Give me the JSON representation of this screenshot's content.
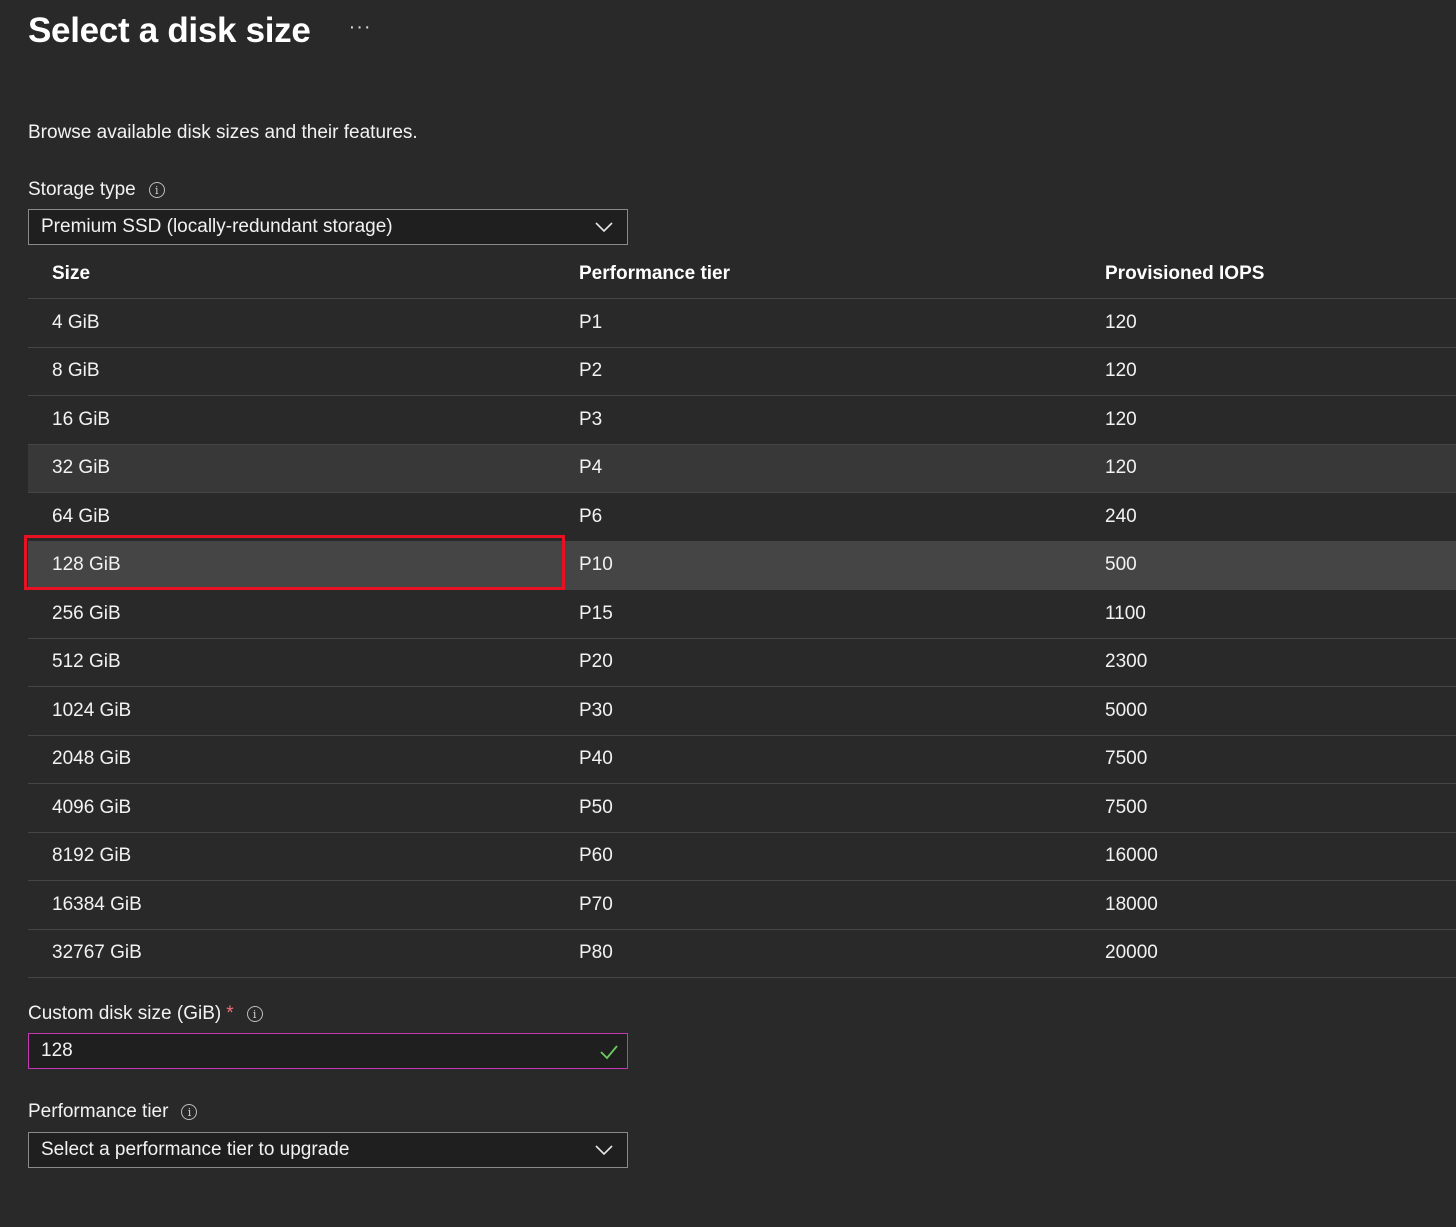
{
  "header": {
    "title": "Select a disk size",
    "more_label": "···"
  },
  "description": "Browse available disk sizes and their features.",
  "storage_type": {
    "label": "Storage type",
    "value": "Premium SSD (locally-redundant storage)",
    "info_icon": "info-icon"
  },
  "table": {
    "columns": [
      "Size",
      "Performance tier",
      "Provisioned IOPS"
    ],
    "rows": [
      {
        "size": "4 GiB",
        "tier": "P1",
        "iops": "120"
      },
      {
        "size": "8 GiB",
        "tier": "P2",
        "iops": "120"
      },
      {
        "size": "16 GiB",
        "tier": "P3",
        "iops": "120"
      },
      {
        "size": "32 GiB",
        "tier": "P4",
        "iops": "120"
      },
      {
        "size": "64 GiB",
        "tier": "P6",
        "iops": "240"
      },
      {
        "size": "128 GiB",
        "tier": "P10",
        "iops": "500"
      },
      {
        "size": "256 GiB",
        "tier": "P15",
        "iops": "1100"
      },
      {
        "size": "512 GiB",
        "tier": "P20",
        "iops": "2300"
      },
      {
        "size": "1024 GiB",
        "tier": "P30",
        "iops": "5000"
      },
      {
        "size": "2048 GiB",
        "tier": "P40",
        "iops": "7500"
      },
      {
        "size": "4096 GiB",
        "tier": "P50",
        "iops": "7500"
      },
      {
        "size": "8192 GiB",
        "tier": "P60",
        "iops": "16000"
      },
      {
        "size": "16384 GiB",
        "tier": "P70",
        "iops": "18000"
      },
      {
        "size": "32767 GiB",
        "tier": "P80",
        "iops": "20000"
      }
    ],
    "hovered_row": "32 GiB",
    "selected_row": "128 GiB"
  },
  "custom_size": {
    "label": "Custom disk size (GiB)",
    "required_mark": "*",
    "value": "128",
    "valid_icon": "checkmark-icon"
  },
  "performance_tier": {
    "label": "Performance tier",
    "placeholder": "Select a performance tier to upgrade"
  },
  "colors": {
    "background": "#292929",
    "selected_row": "#454545",
    "highlight_border": "#e81123",
    "input_focus_border": "#c239b3",
    "valid_check": "#6ccb5f"
  }
}
